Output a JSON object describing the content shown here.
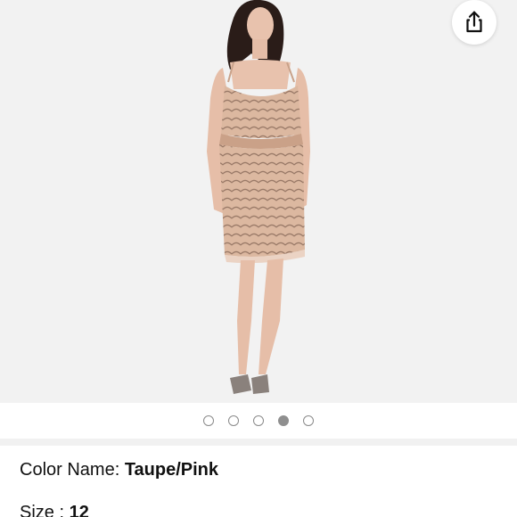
{
  "product": {
    "image_alt": "Taupe/Pink beaded blouson cocktail dress",
    "carousel": {
      "count": 5,
      "active_index": 3
    }
  },
  "details": {
    "color_label": "Color Name: ",
    "color_value": "Taupe/Pink",
    "size_label": "Size : ",
    "size_value": "12"
  },
  "icons": {
    "share": "share-icon"
  },
  "colors": {
    "image_background": "#f2f2f2",
    "dress": "#d9b39a",
    "dot_active": "#8f8f8f"
  }
}
